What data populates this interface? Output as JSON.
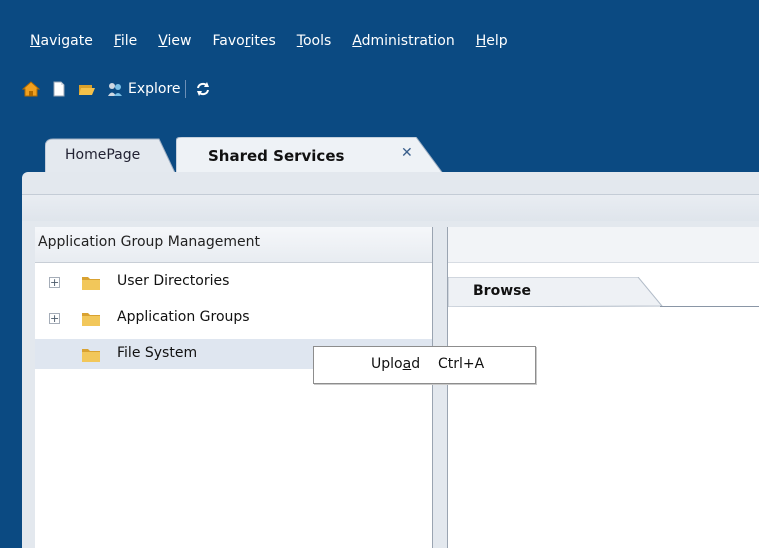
{
  "colors": {
    "header_bg": "#0b4a82",
    "panel_bg": "#e3e8ee",
    "selection": "#dfe6f0",
    "folder": "#e7b63c"
  },
  "menu": [
    {
      "label": "Navigate",
      "mnemonic": "N"
    },
    {
      "label": "File",
      "mnemonic": "F"
    },
    {
      "label": "View",
      "mnemonic": "V"
    },
    {
      "label": "Favorites",
      "mnemonic": "r"
    },
    {
      "label": "Tools",
      "mnemonic": "T"
    },
    {
      "label": "Administration",
      "mnemonic": "A"
    },
    {
      "label": "Help",
      "mnemonic": "H"
    }
  ],
  "toolbar": {
    "icons": [
      "home-icon",
      "new-document-icon",
      "open-folder-icon",
      "explore-icon",
      "refresh-icon"
    ],
    "explore_label": "Explore"
  },
  "tabs": [
    {
      "label": "HomePage",
      "active": false
    },
    {
      "label": "Shared Services",
      "active": true,
      "close_icon": "close-icon"
    }
  ],
  "left_pane": {
    "header": "Application Group Management",
    "tree": [
      {
        "label": "User Directories",
        "expandable": true,
        "expander": "+",
        "icon": "folder-icon"
      },
      {
        "label": "Application Groups",
        "expandable": true,
        "expander": "+",
        "icon": "folder-icon"
      },
      {
        "label": "File System",
        "expandable": false,
        "icon": "folder-icon",
        "selected": true
      }
    ]
  },
  "right_pane": {
    "tab": "Browse"
  },
  "context_menu": {
    "items": [
      {
        "label_pre": "Uplo",
        "label_mnemonic": "a",
        "label_post": "d",
        "shortcut": "Ctrl+A"
      }
    ]
  }
}
